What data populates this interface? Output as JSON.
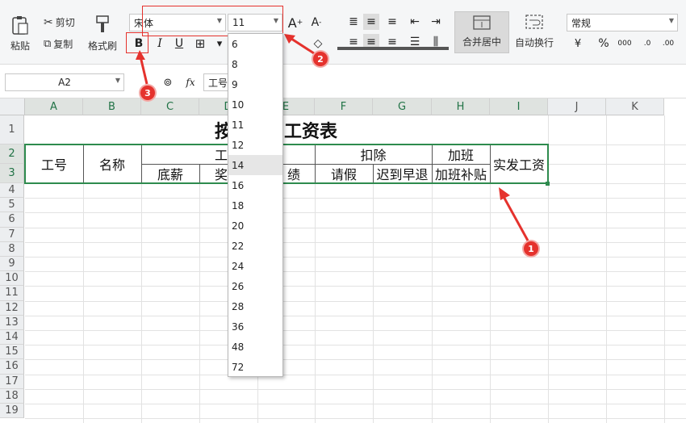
{
  "ribbon": {
    "paste": "粘贴",
    "cut": "剪切",
    "copy": "复制",
    "format_painter": "格式刷",
    "font_name": "宋体",
    "font_size": "11",
    "bold": "B",
    "italic": "I",
    "underline": "U",
    "merge_center": "合并居中",
    "wrap_text": "自动换行",
    "number_format": "常规"
  },
  "formula_bar": {
    "name_box": "A2",
    "fx": "fx",
    "content": "工号"
  },
  "columns": [
    "A",
    "B",
    "C",
    "D",
    "E",
    "F",
    "G",
    "H",
    "I",
    "J",
    "K"
  ],
  "rows": [
    "1",
    "2",
    "3",
    "4",
    "5",
    "6",
    "7",
    "8",
    "9",
    "10",
    "11",
    "12",
    "13",
    "14",
    "15",
    "16",
    "17",
    "18",
    "19"
  ],
  "sheet": {
    "title_left": "按",
    "title_right": "工资表",
    "gonghao": "工号",
    "mingcheng": "名称",
    "gong_partial": "工",
    "kouchu": "扣除",
    "jiaban": "加班",
    "shifa": "实发工资",
    "dixin": "底薪",
    "jiang_partial": "奖",
    "jixiao_partial": "绩",
    "qingjia": "请假",
    "chidao": "迟到早退",
    "jiaban_butie": "加班补贴"
  },
  "font_sizes": [
    "6",
    "8",
    "9",
    "10",
    "11",
    "12",
    "14",
    "16",
    "18",
    "20",
    "22",
    "24",
    "26",
    "28",
    "36",
    "48",
    "72"
  ],
  "highlighted_size": "14",
  "annotations": [
    "1",
    "2",
    "3"
  ]
}
